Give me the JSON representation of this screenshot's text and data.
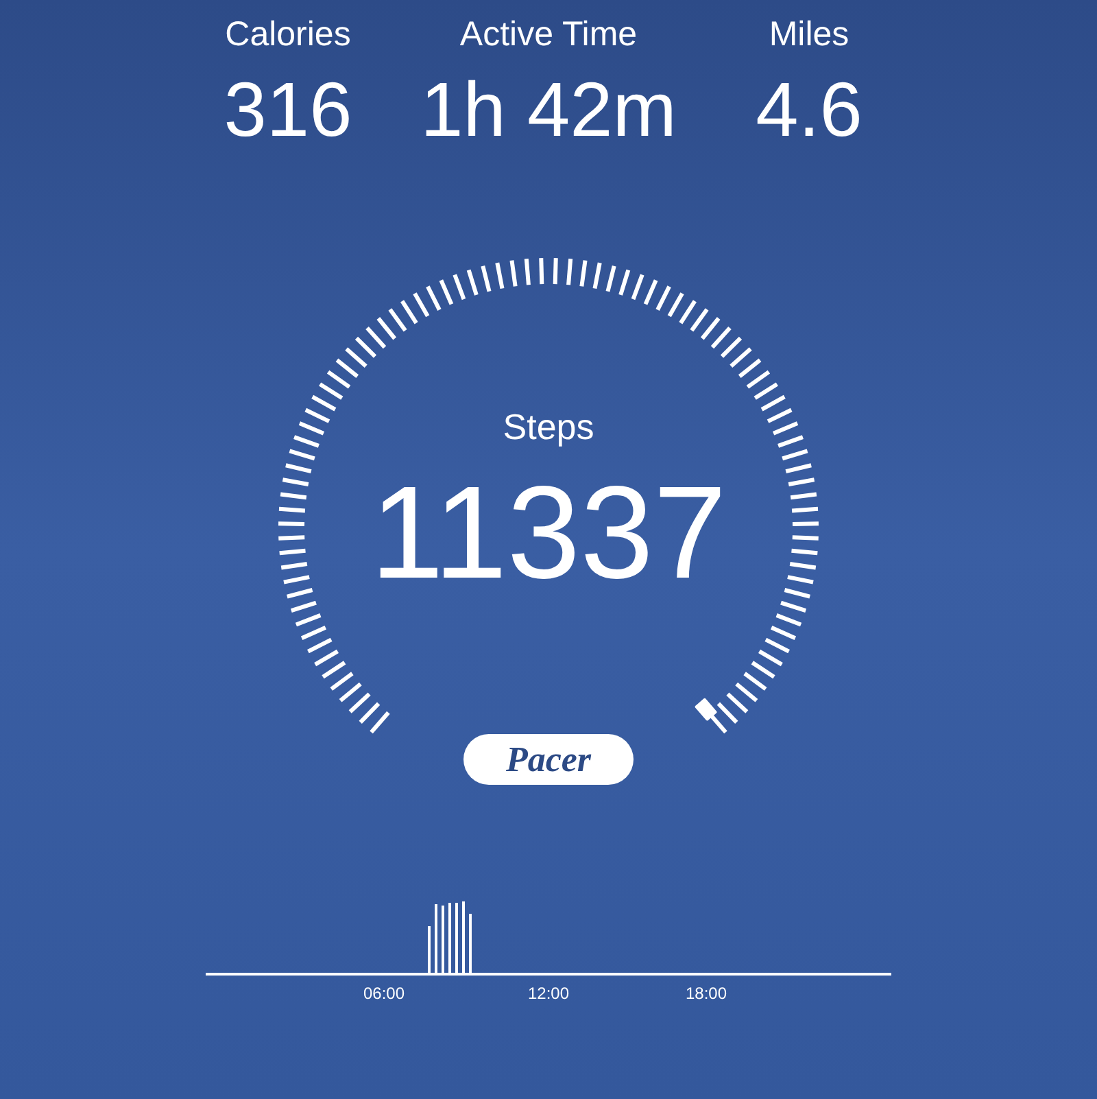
{
  "stats": [
    {
      "label": "Calories",
      "value": "316"
    },
    {
      "label": "Active Time",
      "value": "1h 42m"
    },
    {
      "label": "Miles",
      "value": "4.6"
    }
  ],
  "steps": {
    "label": "Steps",
    "value": "11337"
  },
  "brand": "Pacer",
  "activity": {
    "ticks": [
      "06:00",
      "12:00",
      "18:00"
    ]
  }
}
